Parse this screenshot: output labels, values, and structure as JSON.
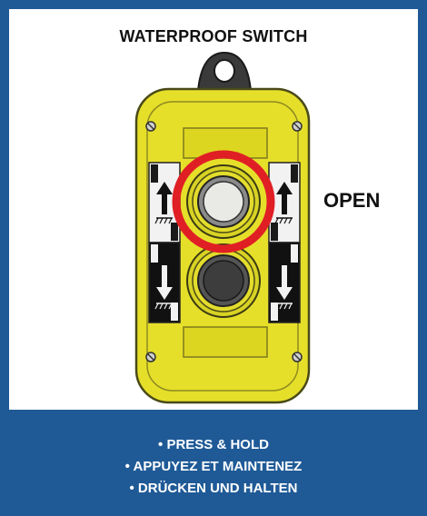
{
  "title": "WATERPROOF SWITCH",
  "state_label": "OPEN",
  "instructions": [
    "• PRESS & HOLD",
    "• APPUYEZ ET MAINTENEZ",
    "• DRÜCKEN UND HALTEN"
  ],
  "colors": {
    "frame": "#1f5a97",
    "housing": "#e6df2a",
    "housing_outline": "#55551c",
    "highlight_ring": "#e01f25",
    "up_button": "#e9e9e6",
    "down_button": "#3d3d3d"
  },
  "icons": {
    "up_arrow": "up-arrow-icon",
    "down_arrow": "down-arrow-icon",
    "mounting_hole": "hanging-loop-icon"
  }
}
